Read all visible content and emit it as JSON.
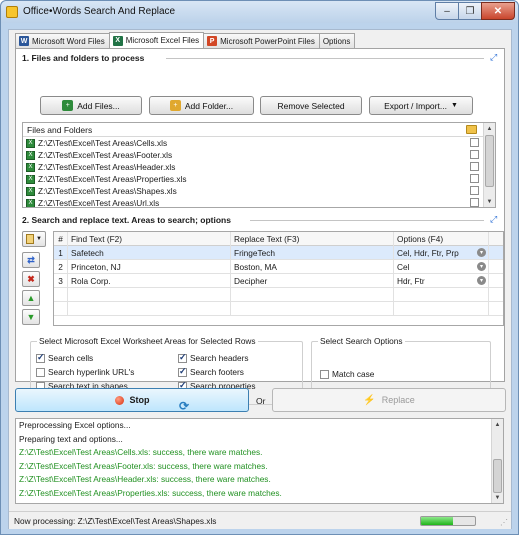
{
  "window": {
    "title": "Office•Words Search And Replace",
    "min_glyph": "–",
    "max_glyph": "❐",
    "close_glyph": "✕"
  },
  "tabs": [
    {
      "label": "Microsoft Word Files",
      "icon": "word-doc-icon",
      "glyph": "W",
      "color": "#2b579a"
    },
    {
      "label": "Microsoft Excel Files",
      "icon": "excel-doc-icon",
      "glyph": "X",
      "color": "#217346",
      "active": true
    },
    {
      "label": "Microsoft PowerPoint Files",
      "icon": "powerpoint-doc-icon",
      "glyph": "P",
      "color": "#d24726"
    },
    {
      "label": "Options"
    }
  ],
  "section1": {
    "title": "1. Files and folders to process",
    "buttons": {
      "add_files": "Add Files...",
      "add_folder": "Add Folder...",
      "remove_selected": "Remove Selected",
      "export_import": "Export / Import..."
    },
    "list_header": "Files and Folders",
    "files": [
      "Z:\\Z\\Test\\Excel\\Test Areas\\Cells.xls",
      "Z:\\Z\\Test\\Excel\\Test Areas\\Footer.xls",
      "Z:\\Z\\Test\\Excel\\Test Areas\\Header.xls",
      "Z:\\Z\\Test\\Excel\\Test Areas\\Properties.xls",
      "Z:\\Z\\Test\\Excel\\Test Areas\\Shapes.xls",
      "Z:\\Z\\Test\\Excel\\Test Areas\\Url.xls"
    ]
  },
  "section2": {
    "title": "2. Search and replace text. Areas to search; options",
    "columns": {
      "num": "#",
      "find": "Find Text (F2)",
      "replace": "Replace Text (F3)",
      "options": "Options (F4)"
    },
    "rows": [
      {
        "num": "1",
        "find": "Safetech",
        "replace": "FringeTech",
        "options": "Cel, Hdr, Ftr, Prp"
      },
      {
        "num": "2",
        "find": "Princeton, NJ",
        "replace": "Boston, MA",
        "options": "Cel"
      },
      {
        "num": "3",
        "find": "Rola Corp.",
        "replace": "Decipher",
        "options": "Hdr, Ftr"
      }
    ],
    "areas_title": "Select Microsoft Excel Worksheet Areas for Selected Rows",
    "areas": {
      "search_cells": "Search cells",
      "search_hyperlinks": "Search hyperlink URL's",
      "search_shapes": "Search text in shapes",
      "search_headers": "Search headers",
      "search_footers": "Search footers",
      "search_properties": "Search properties"
    },
    "search_options_title": "Select Search Options",
    "match_case": "Match case"
  },
  "actions": {
    "stop": "Stop",
    "or": "Or",
    "replace": "Replace"
  },
  "log": [
    {
      "text": "Preprocessing Excel options...",
      "status": "info"
    },
    {
      "text": "Preparing text and options...",
      "status": "info"
    },
    {
      "text": "Z:\\Z\\Test\\Excel\\Test Areas\\Cells.xls: success, there ware matches.",
      "status": "success"
    },
    {
      "text": "Z:\\Z\\Test\\Excel\\Test Areas\\Footer.xls: success, there ware matches.",
      "status": "success"
    },
    {
      "text": "Z:\\Z\\Test\\Excel\\Test Areas\\Header.xls: success, there ware matches.",
      "status": "success"
    },
    {
      "text": "Z:\\Z\\Test\\Excel\\Test Areas\\Properties.xls: success, there ware matches.",
      "status": "success"
    }
  ],
  "status": {
    "text": "Now processing: Z:\\Z\\Test\\Excel\\Test Areas\\Shapes.xls",
    "progress": 0.6
  },
  "colors": {
    "success": "#209020",
    "accent": "#3c7fb1"
  }
}
